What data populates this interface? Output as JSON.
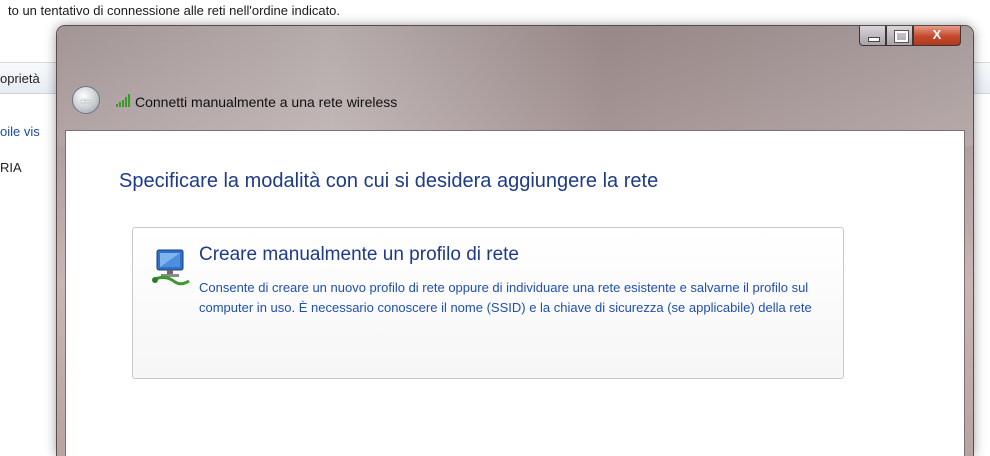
{
  "background": {
    "header_text": "to un tentativo di connessione alle reti nell'ordine indicato.",
    "toolbar_item": "oprietà",
    "list_line_1": "oile vis",
    "list_line_2": "RIA"
  },
  "window": {
    "title": "Connetti manualmente a una rete wireless",
    "caption": {
      "minimize_icon": "minimize-icon",
      "maximize_icon": "maximize-icon",
      "close_glyph": "X"
    },
    "back_glyph": "←"
  },
  "content": {
    "main_instruction": "Specificare la modalità con cui si desidera aggiungere la rete",
    "option": {
      "title": "Creare manualmente un profilo di rete",
      "description": "Consente di creare un nuovo profilo di rete oppure di individuare una rete esistente e salvarne il profilo sul computer in uso. È necessario conoscere il nome (SSID) e la chiave di sicurezza (se applicabile) della rete",
      "icon": "network-computer-icon"
    }
  },
  "colors": {
    "heading_blue": "#1e3a8a",
    "link_blue": "#1f4fb3",
    "close_red": "#c34a2c"
  }
}
